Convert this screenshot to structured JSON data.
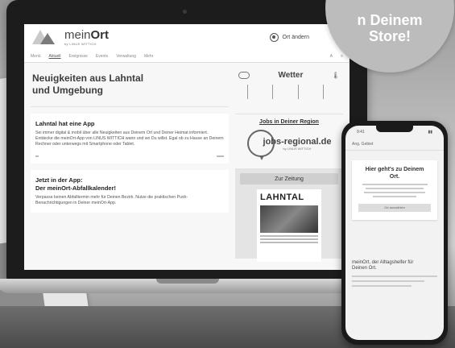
{
  "badge": {
    "line1": "n Deinem",
    "line2": "Store!"
  },
  "site": {
    "brand_prefix": "mein",
    "brand_suffix": "Ort",
    "brand_sub": "by LINUS WITTICH",
    "location_label": "Ort ändern",
    "nav": [
      "Menü",
      "Aktuell",
      "Ereignisse",
      "Events",
      "Verwaltung",
      "Mehr"
    ],
    "nav_tools": [
      "A",
      "≡"
    ]
  },
  "hero": {
    "title_line1": "Neuigkeiten aus Lahntal",
    "title_line2": "und Umgebung"
  },
  "app_card": {
    "title": "Lahntal hat eine App",
    "text": "Sei immer digital & mobil über alle Neuigkeiten aus Deinem Ort und Deiner Heimat informiert. Entdecke die meinOrt-App von LINUS WITTICH wann und wo Du willst. Egal ob zu Hause an Deinem Rechner oder unterwegs mit Smartphone oder Tablet."
  },
  "waste_card": {
    "title_line1": "Jetzt in der App:",
    "title_line2": "Der meinOrt-Abfallkalender!",
    "text": "Verpasse keinen Abfalltermin mehr für Deinen Bezirk. Nutze die praktischen Push-Benachrichtigungen in Deiner meinOrt-App."
  },
  "weather": {
    "title": "Wetter",
    "temp_icon": "thermometer-icon"
  },
  "jobs": {
    "link": "Jobs in Deiner Region",
    "logo_prefix": "jobs-",
    "logo_main": "regional.de",
    "logo_sub": "by LINUS WITTICH"
  },
  "newspaper": {
    "button": "Zur Zeitung",
    "masthead": "LAHNTAL"
  },
  "phone": {
    "time": "9:41",
    "logo": "Ang. Gebiet",
    "card_title_line1": "Hier geht's zu Deinem",
    "card_title_line2": "Ort.",
    "card_button": "Ort auswählen",
    "footer_line1": "meinOrt, der Alltagshelfer für",
    "footer_line2": "Deinen Ort."
  }
}
